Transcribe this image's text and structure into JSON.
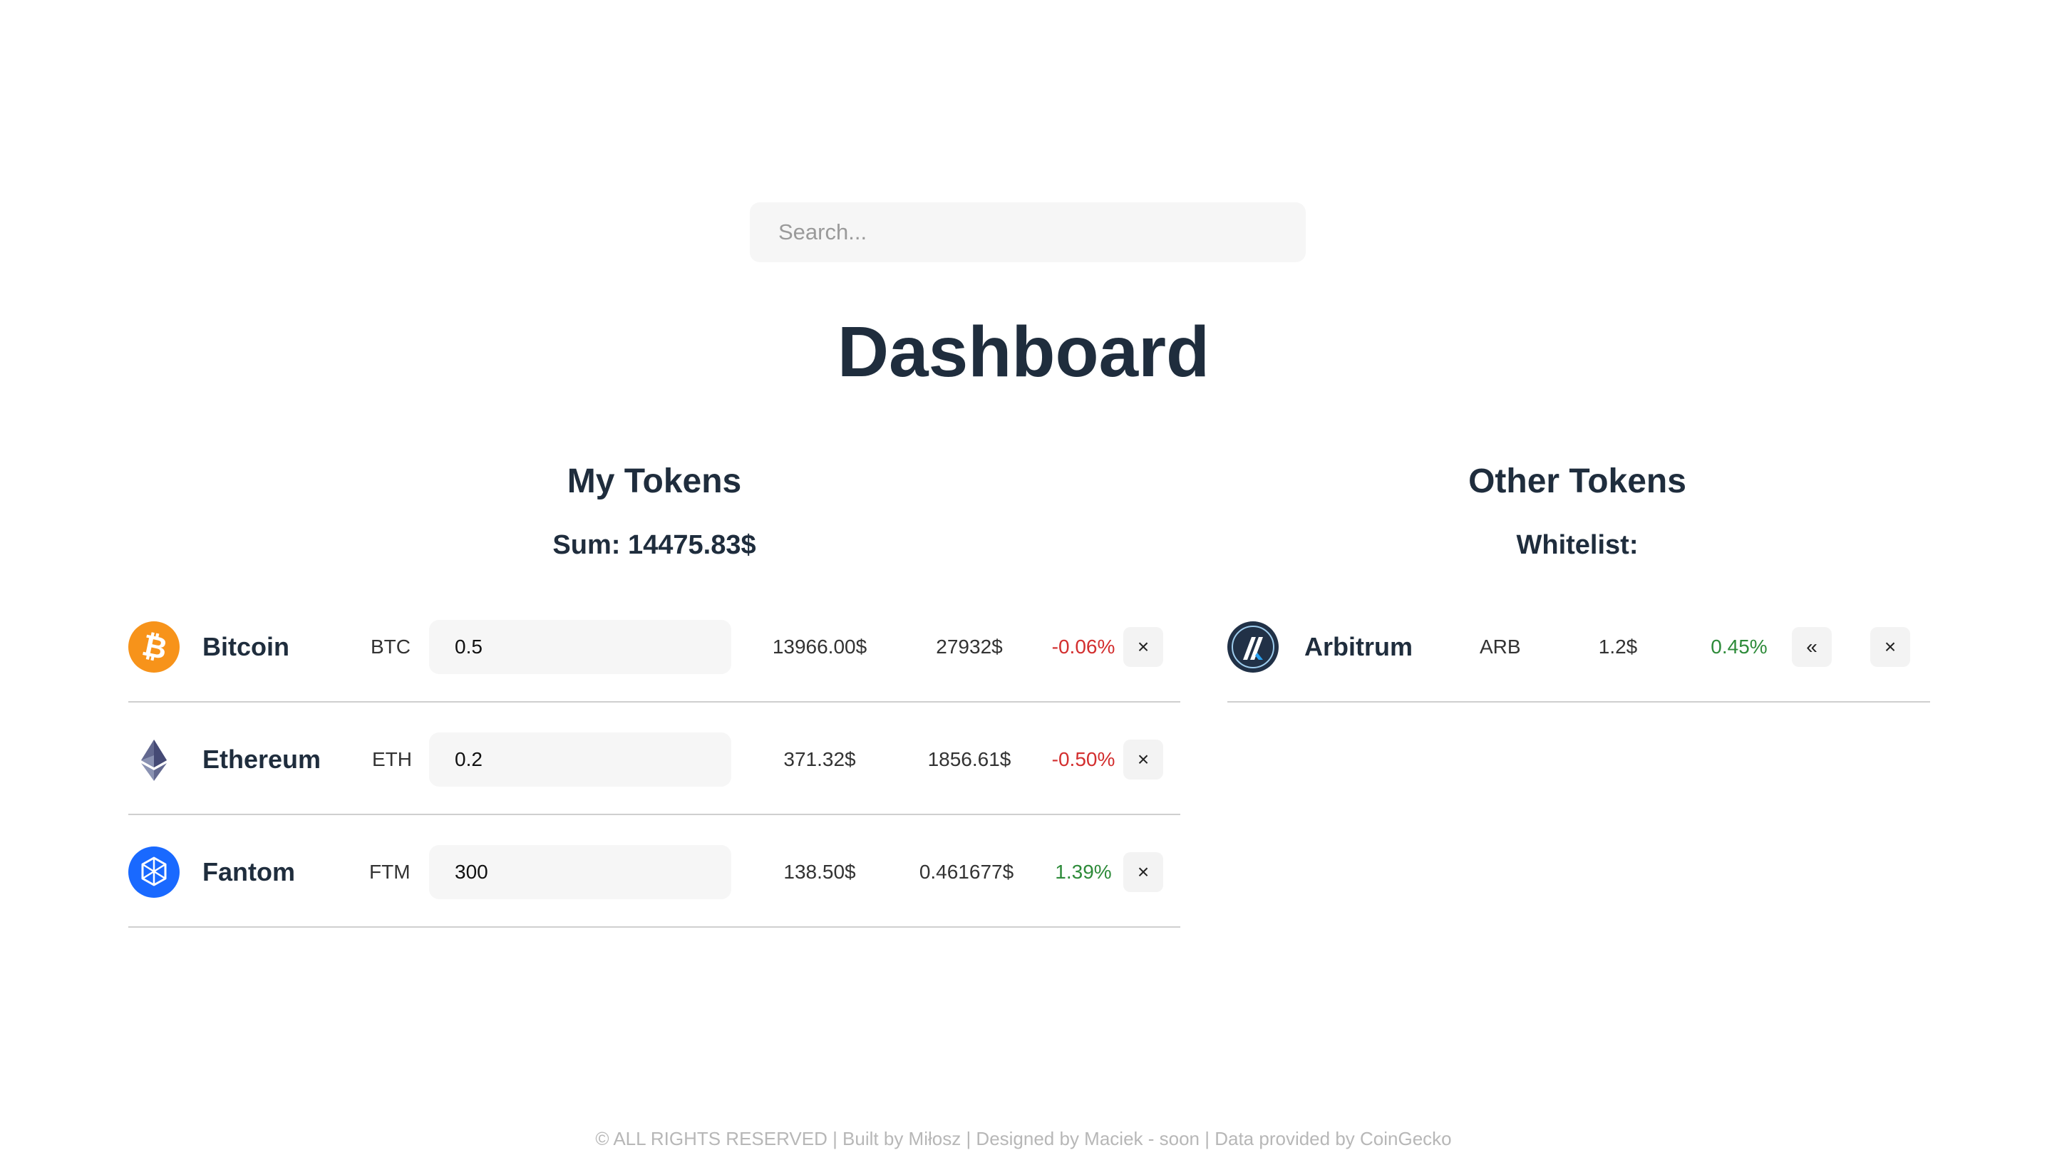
{
  "search": {
    "placeholder": "Search..."
  },
  "page": {
    "title": "Dashboard"
  },
  "my_tokens": {
    "title": "My Tokens",
    "sum_label": "Sum: 14475.83$",
    "rows": [
      {
        "name": "Bitcoin",
        "symbol": "BTC",
        "amount": "0.5",
        "value": "13966.00$",
        "price": "27932$",
        "change": "-0.06%",
        "icon": "bitcoin-icon",
        "remove_label": "×"
      },
      {
        "name": "Ethereum",
        "symbol": "ETH",
        "amount": "0.2",
        "value": "371.32$",
        "price": "1856.61$",
        "change": "-0.50%",
        "icon": "ethereum-icon",
        "remove_label": "×"
      },
      {
        "name": "Fantom",
        "symbol": "FTM",
        "amount": "300",
        "value": "138.50$",
        "price": "0.461677$",
        "change": "1.39%",
        "icon": "fantom-icon",
        "remove_label": "×"
      }
    ]
  },
  "other_tokens": {
    "title": "Other Tokens",
    "whitelist_label": "Whitelist:",
    "rows": [
      {
        "name": "Arbitrum",
        "symbol": "ARB",
        "price": "1.2$",
        "change": "0.45%",
        "icon": "arbitrum-icon",
        "add_label": "«",
        "remove_label": "×"
      }
    ]
  },
  "footer": {
    "text": "© ALL RIGHTS RESERVED | Built by Miłosz | Designed by Maciek - soon | Data provided by CoinGecko"
  },
  "colors": {
    "heading": "#1f2d3d",
    "negative": "#d32f2f",
    "positive": "#2e8b3a",
    "input_bg": "#f6f6f6",
    "bitcoin": "#f7931a",
    "fantom": "#1969ff",
    "arbitrum_dark": "#213147",
    "arbitrum_blue": "#28a0f0"
  }
}
